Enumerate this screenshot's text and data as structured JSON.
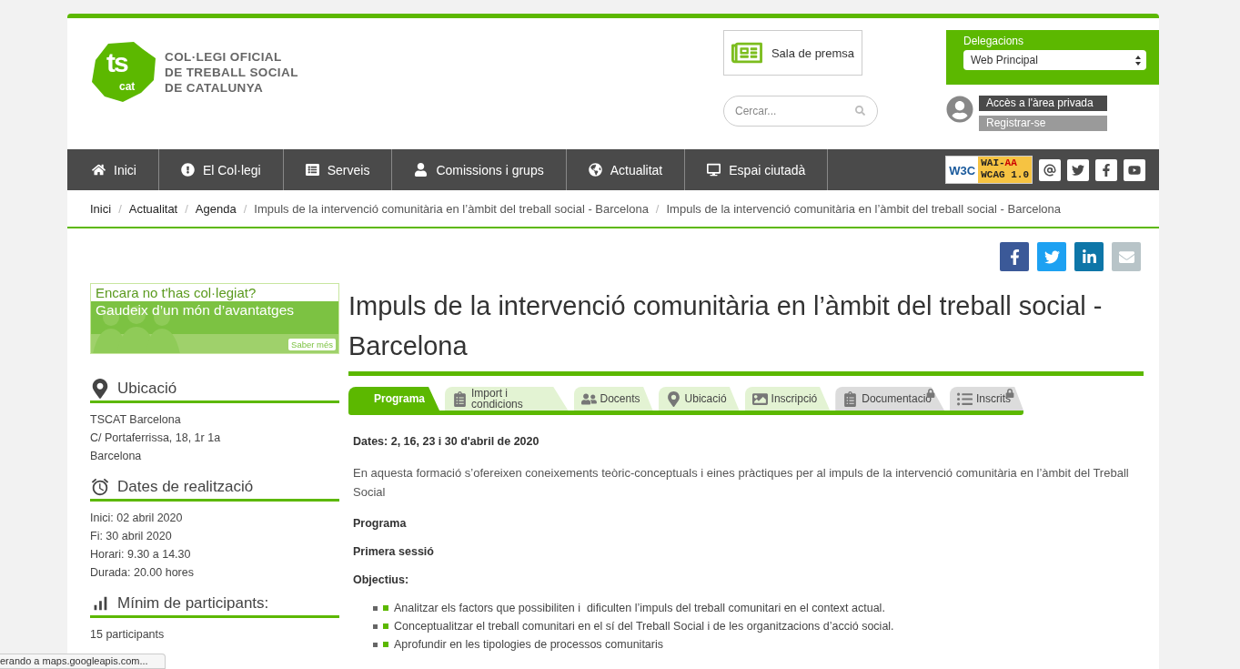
{
  "logo": {
    "mark": "ts",
    "sub": "cat",
    "lines": [
      "COL·LEGI OFICIAL",
      "DE TREBALL SOCIAL",
      "DE CATALUNYA"
    ]
  },
  "press_room": {
    "label": "Sala de premsa"
  },
  "search": {
    "placeholder": "Cercar..."
  },
  "delegations": {
    "label": "Delegacions",
    "value": "Web Principal"
  },
  "account": {
    "login": "Accès a l'àrea privada",
    "register": "Registrar-se"
  },
  "nav": [
    {
      "label": "Inici"
    },
    {
      "label": "El Col·legi"
    },
    {
      "label": "Serveis"
    },
    {
      "label": "Comissions i grups"
    },
    {
      "label": "Actualitat"
    },
    {
      "label": "Espai ciutadà"
    }
  ],
  "accessibility_badge": {
    "logo": "W3C",
    "level_prefix": "WAI-",
    "level": "AA",
    "standard": "WCAG 1.0"
  },
  "breadcrumb_separator": "/",
  "breadcrumb": [
    "Inici",
    "Actualitat",
    "Agenda",
    "Impuls de la intervenció comunitària en l’àmbit del treball social - Barcelona",
    "Impuls de la intervenció comunitària en l’àmbit del treball social - Barcelona"
  ],
  "promo": {
    "question": "Encara no t'has col·legiat?",
    "tagline": "Gaudeix d’un món d’avantatges",
    "button": "Saber més"
  },
  "sidebar": [
    {
      "title": "Ubicació",
      "lines": [
        "TSCAT Barcelona",
        "C/ Portaferrissa, 18, 1r 1a",
        "Barcelona"
      ]
    },
    {
      "title": "Dates de realització",
      "lines": [
        "Inici: 02 abril 2020",
        "Fi: 30 abril 2020",
        "Horari: 9.30 a 14.30",
        "Durada: 20.00 hores"
      ]
    },
    {
      "title": "Mínim de participants:",
      "lines": [
        "15 participants"
      ]
    }
  ],
  "title": "Impuls de la intervenció comunitària en l’àmbit del treball social - Barcelona",
  "tabs": [
    {
      "label": "Programa",
      "selected": true,
      "locked": false
    },
    {
      "label": "Import i condicions",
      "selected": false,
      "locked": false
    },
    {
      "label": "Docents",
      "selected": false,
      "locked": false
    },
    {
      "label": "Ubicació",
      "selected": false,
      "locked": false
    },
    {
      "label": "Inscripció",
      "selected": false,
      "locked": false
    },
    {
      "label": "Documentació",
      "selected": false,
      "locked": true
    },
    {
      "label": "Inscrits",
      "selected": false,
      "locked": true
    }
  ],
  "content": {
    "dates": "Dates: 2, 16, 23 i 30 d'abril de 2020",
    "intro": "En aquesta formació s’ofereixen coneixements teòric-conceptuals i eines pràctiques per al impuls de la intervenció comunitària en l’àmbit del Treball Social",
    "headings": [
      "Programa",
      "Primera sessió",
      "Objectius:"
    ],
    "objectives": [
      "Analitzar els factors que possibiliten i  dificulten l’impuls del treball comunitari en el context actual.",
      "Conceptualitzar el treball comunitari en el sí del Treball Social i de les organitzacions d’acció social.",
      "Aprofundir en les tipologies de processos comunitaris"
    ]
  },
  "status_bar": "erando a maps.googleapis.com..."
}
